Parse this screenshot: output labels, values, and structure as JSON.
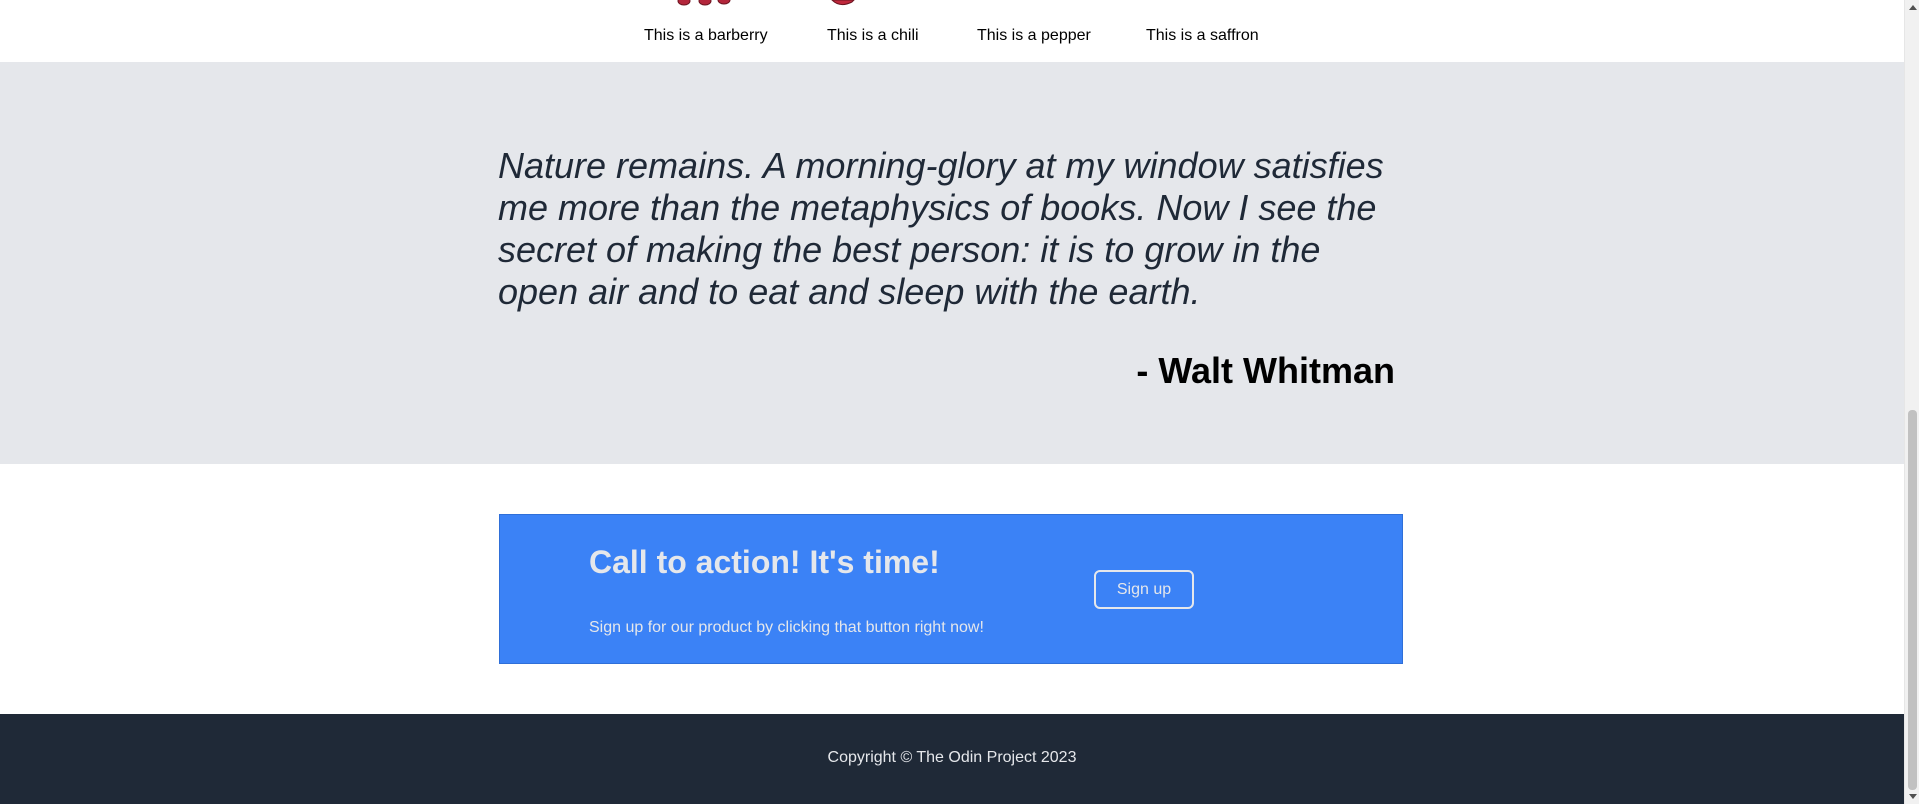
{
  "spices": [
    {
      "caption": "This is a barberry",
      "icon": "barberry-icon"
    },
    {
      "caption": "This is a chili",
      "icon": "chili-icon"
    },
    {
      "caption": "This is a pepper",
      "icon": "pepper-icon"
    },
    {
      "caption": "This is a saffron",
      "icon": "saffron-icon"
    }
  ],
  "quote": {
    "text": "Nature remains. A morning-glory at my window satisfies me more than the metaphysics of books. Now I see the secret of making the best person: it is to grow in the open air and to eat and sleep with the earth.",
    "author": "- Walt Whitman"
  },
  "cta": {
    "title": "Call to action! It's time!",
    "subtitle": "Sign up for our product by clicking that button right now!",
    "button_label": "Sign up"
  },
  "footer": {
    "copyright": "Copyright © The Odin Project 2023"
  },
  "colors": {
    "quote_bg": "#e5e7eb",
    "cta_bg": "#3b82f6",
    "footer_bg": "#1f2937",
    "light_text": "#e5e7eb",
    "spice_red": "#b3263b"
  }
}
